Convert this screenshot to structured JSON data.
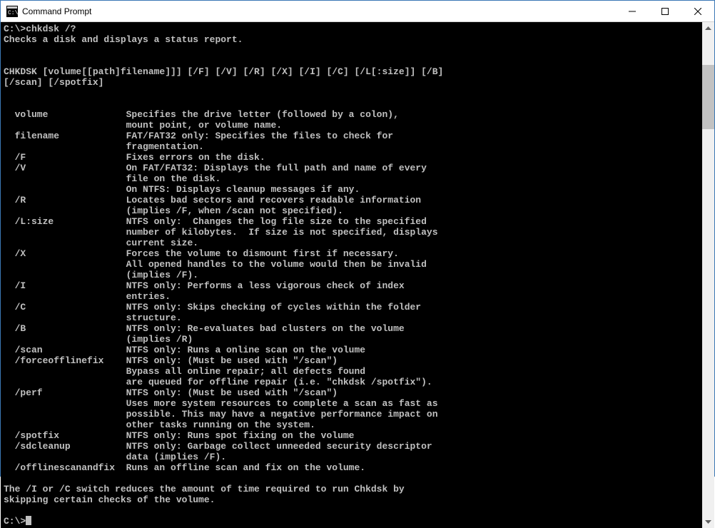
{
  "titlebar": {
    "title": "Command Prompt"
  },
  "session": {
    "prompt1": "C:\\>chkdsk /?",
    "desc": "Checks a disk and displays a status report.",
    "blank": "",
    "usage1": "CHKDSK [volume[[path]filename]]] [/F] [/V] [/R] [/X] [/I] [/C] [/L[:size]] [/B]",
    "usage2": "[/scan] [/spotfix]",
    "p01": "  volume              Specifies the drive letter (followed by a colon),",
    "p02": "                      mount point, or volume name.",
    "p03": "  filename            FAT/FAT32 only: Specifies the files to check for",
    "p04": "                      fragmentation.",
    "p05": "  /F                  Fixes errors on the disk.",
    "p06": "  /V                  On FAT/FAT32: Displays the full path and name of every",
    "p07": "                      file on the disk.",
    "p08": "                      On NTFS: Displays cleanup messages if any.",
    "p09": "  /R                  Locates bad sectors and recovers readable information",
    "p10": "                      (implies /F, when /scan not specified).",
    "p11": "  /L:size             NTFS only:  Changes the log file size to the specified",
    "p12": "                      number of kilobytes.  If size is not specified, displays",
    "p13": "                      current size.",
    "p14": "  /X                  Forces the volume to dismount first if necessary.",
    "p15": "                      All opened handles to the volume would then be invalid",
    "p16": "                      (implies /F).",
    "p17": "  /I                  NTFS only: Performs a less vigorous check of index",
    "p18": "                      entries.",
    "p19": "  /C                  NTFS only: Skips checking of cycles within the folder",
    "p20": "                      structure.",
    "p21": "  /B                  NTFS only: Re-evaluates bad clusters on the volume",
    "p22": "                      (implies /R)",
    "p23": "  /scan               NTFS only: Runs a online scan on the volume",
    "p24": "  /forceofflinefix    NTFS only: (Must be used with \"/scan\")",
    "p25": "                      Bypass all online repair; all defects found",
    "p26": "                      are queued for offline repair (i.e. \"chkdsk /spotfix\").",
    "p27": "  /perf               NTFS only: (Must be used with \"/scan\")",
    "p28": "                      Uses more system resources to complete a scan as fast as",
    "p29": "                      possible. This may have a negative performance impact on",
    "p30": "                      other tasks running on the system.",
    "p31": "  /spotfix            NTFS only: Runs spot fixing on the volume",
    "p32": "  /sdcleanup          NTFS only: Garbage collect unneeded security descriptor",
    "p33": "                      data (implies /F).",
    "p34": "  /offlinescanandfix  Runs an offline scan and fix on the volume.",
    "foot1": "The /I or /C switch reduces the amount of time required to run Chkdsk by",
    "foot2": "skipping certain checks of the volume.",
    "prompt2": "C:\\>"
  }
}
